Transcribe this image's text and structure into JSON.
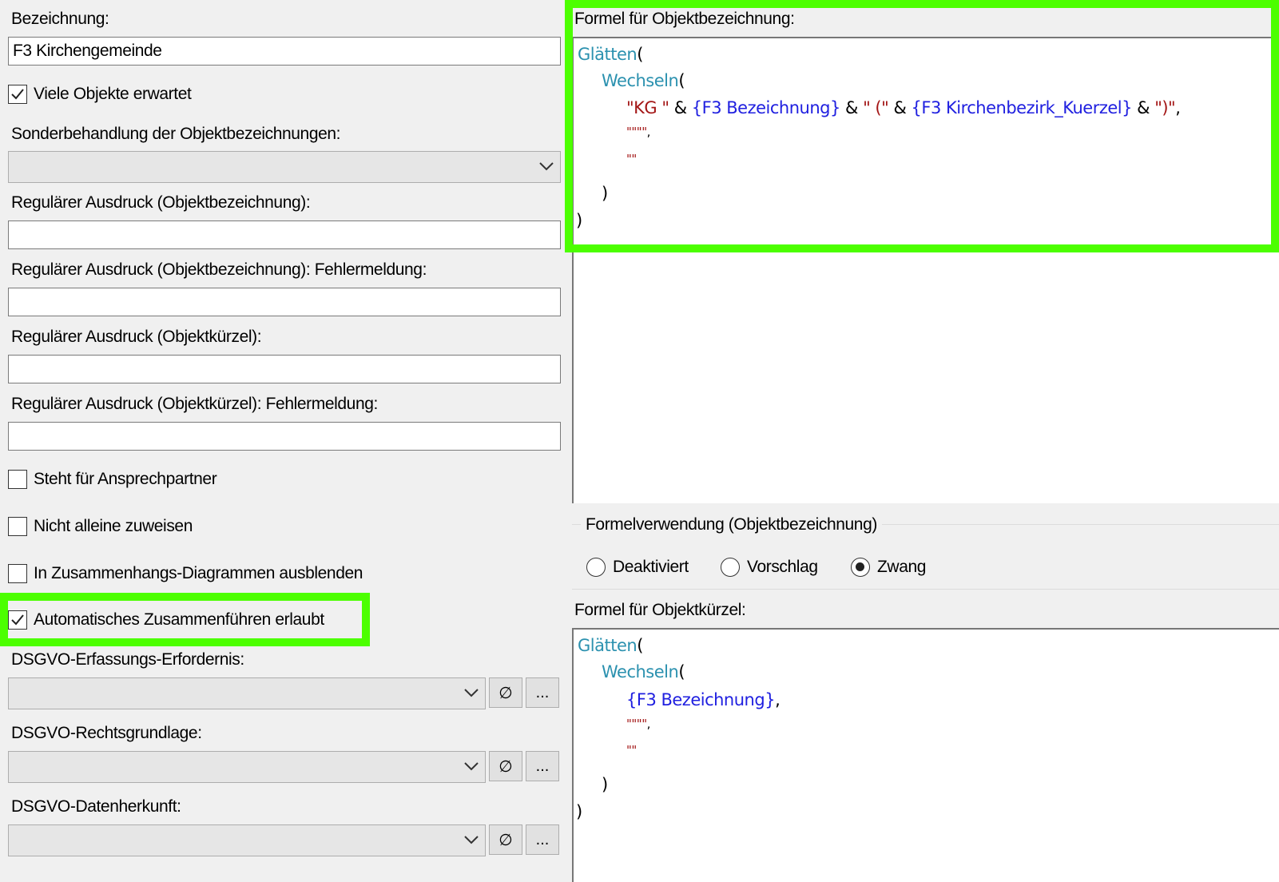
{
  "left": {
    "bezeichnung_label": "Bezeichnung:",
    "bezeichnung_value": "F3 Kirchengemeinde",
    "viele_objekte": "Viele Objekte erwartet",
    "sonderbehandlung_label": "Sonderbehandlung der Objektbezeichnungen:",
    "regex_bez_label": "Regulärer Ausdruck (Objektbezeichnung):",
    "regex_bez_err_label": "Regulärer Ausdruck (Objektbezeichnung): Fehlermeldung:",
    "regex_kurz_label": "Regulärer Ausdruck (Objektkürzel):",
    "regex_kurz_err_label": "Regulärer Ausdruck (Objektkürzel): Fehlermeldung:",
    "ansprechpartner": "Steht für Ansprechpartner",
    "nicht_alleine": "Nicht alleine zuweisen",
    "diagramme": "In Zusammenhangs-Diagrammen ausblenden",
    "auto_zusammen": "Automatisches Zusammenführen erlaubt",
    "dsgvo_erfassung_label": "DSGVO-Erfassungs-Erfordernis:",
    "dsgvo_recht_label": "DSGVO-Rechtsgrundlage:",
    "dsgvo_herkunft_label": "DSGVO-Datenherkunft:",
    "clear_glyph": "∅",
    "more_glyph": "..."
  },
  "right": {
    "formula_bez_label": "Formel für Objektbezeichnung:",
    "formula_bez": {
      "l1_fn": "Glätten",
      "l1_paren": "(",
      "l2_fn": "Wechseln",
      "l2_paren": "(",
      "l3_s1": "\"KG \"",
      "l3_amp1": " & ",
      "l3_f1": "{F3 Bezeichnung}",
      "l3_amp2": " & ",
      "l3_s2": "\" (\"",
      "l3_amp3": " & ",
      "l3_f2": "{F3 Kirchenbezirk_Kuerzel}",
      "l3_amp4": " & ",
      "l3_s3": "\")\"",
      "l3_comma": ",",
      "l4_str": "\"\"\"\"",
      "l4_comma": ",",
      "l5_str": "\"\"",
      "l6": ")",
      "l7": ")"
    },
    "formelverwendung_label": "Formelverwendung (Objektbezeichnung)",
    "radio_deaktiviert": "Deaktiviert",
    "radio_vorschlag": "Vorschlag",
    "radio_zwang": "Zwang",
    "formula_kurz_label": "Formel für Objektkürzel:",
    "formula_kurz": {
      "l1_fn": "Glätten",
      "l1_paren": "(",
      "l2_fn": "Wechseln",
      "l2_paren": "(",
      "l3_f1": "{F3 Bezeichnung}",
      "l3_comma": ",",
      "l4_str": "\"\"\"\"",
      "l4_comma": ",",
      "l5_str": "\"\"",
      "l6": ")",
      "l7": ")"
    }
  },
  "colors": {
    "highlight": "#4cff00",
    "function": "#2b91af",
    "string": "#a31515",
    "field": "#2020e0"
  }
}
